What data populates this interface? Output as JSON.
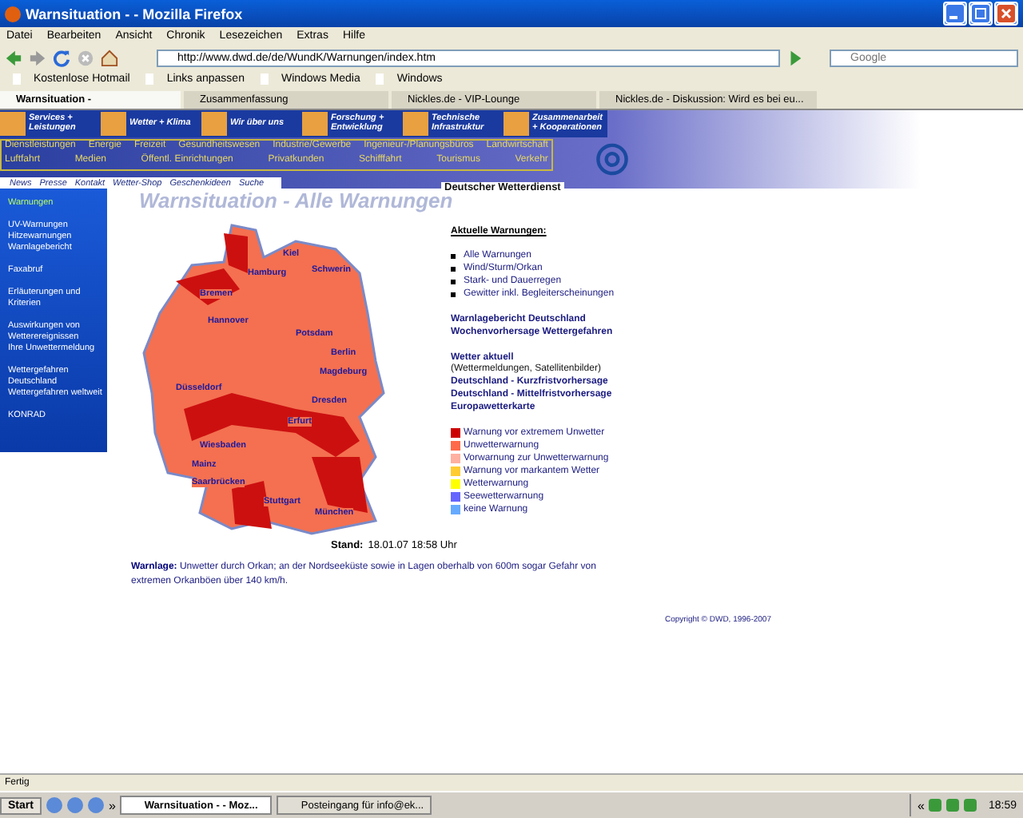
{
  "window": {
    "title": "Warnsituation - - Mozilla Firefox"
  },
  "menu": [
    "Datei",
    "Bearbeiten",
    "Ansicht",
    "Chronik",
    "Lesezeichen",
    "Extras",
    "Hilfe"
  ],
  "address": {
    "value": "http://www.dwd.de/de/WundK/Warnungen/index.htm"
  },
  "search": {
    "placeholder": "Google"
  },
  "bookmarks": [
    "Kostenlose Hotmail",
    "Links anpassen",
    "Windows Media",
    "Windows"
  ],
  "tabs": [
    {
      "label": "Warnsituation -",
      "selected": true
    },
    {
      "label": "Zusammenfassung",
      "selected": false
    },
    {
      "label": "Nickles.de - VIP-Lounge",
      "selected": false
    },
    {
      "label": "Nickles.de - Diskussion: Wird es bei eu...",
      "selected": false
    }
  ],
  "site": {
    "categories": [
      "Services + Leistungen",
      "Wetter + Klima",
      "Wir über uns",
      "Forschung + Entwicklung",
      "Technische Infrastruktur",
      "Zusammenarbeit + Kooperationen"
    ],
    "sectors": [
      [
        "Dienstleistungen",
        "Energie",
        "Freizeit",
        "Gesundheitswesen",
        "Industrie/Gewerbe",
        "Ingenieur-/Planungsbüros",
        "Landwirtschaft"
      ],
      [
        "Luftfahrt",
        "Medien",
        "Öffentl. Einrichtungen",
        "Privatkunden",
        "Schifffahrt",
        "Tourismus",
        "Verkehr"
      ]
    ],
    "subnav": [
      "News",
      "Presse",
      "Kontakt",
      "Wetter-Shop",
      "Geschenkideen",
      "Suche"
    ],
    "org": "Deutscher Wetterdienst",
    "sidebar": [
      {
        "items": [
          "Warnungen"
        ],
        "selected": true
      },
      {
        "items": [
          "UV-Warnungen",
          "Hitzewarnungen",
          "Warnlagebericht"
        ],
        "selected": false
      },
      {
        "items": [
          "Faxabruf"
        ],
        "selected": false
      },
      {
        "items": [
          "Erläuterungen und Kriterien"
        ],
        "selected": false
      },
      {
        "items": [
          "Auswirkungen von Wetterereignissen",
          "Ihre Unwettermeldung"
        ],
        "selected": false
      },
      {
        "items": [
          "Wettergefahren Deutschland",
          "Wettergefahren weltweit"
        ],
        "selected": false
      },
      {
        "items": [
          "KONRAD"
        ],
        "selected": false
      }
    ],
    "heading": "Warnsituation - Alle Warnungen",
    "cities": [
      "Kiel",
      "Hamburg",
      "Schwerin",
      "Bremen",
      "Hannover",
      "Potsdam",
      "Berlin",
      "Magdeburg",
      "Düsseldorf",
      "Dresden",
      "Erfurt",
      "Wiesbaden",
      "Mainz",
      "Saarbrücken",
      "Stuttgart",
      "München"
    ],
    "current_title": "Aktuelle Warnungen:",
    "current_links": [
      "Alle Warnungen",
      "Wind/Sturm/Orkan",
      "Stark- und Dauerregen",
      "Gewitter inkl. Begleiterscheinungen"
    ],
    "link_groups": [
      [
        {
          "text": "Warnlagebericht Deutschland",
          "kind": "link"
        },
        {
          "text": "Wochenvorhersage Wettergefahren",
          "kind": "link"
        }
      ],
      [
        {
          "text": "Wetter aktuell",
          "kind": "link"
        },
        {
          "text": "(Wettermeldungen, Satellitenbilder)",
          "kind": "note"
        },
        {
          "text": "Deutschland - Kurzfristvorhersage",
          "kind": "link"
        },
        {
          "text": "Deutschland - Mittelfristvorhersage",
          "kind": "link"
        },
        {
          "text": "Europawetterkarte",
          "kind": "link"
        }
      ]
    ],
    "legend": [
      {
        "label": "Warnung vor extremem Unwetter",
        "color": "#cc0000"
      },
      {
        "label": "Unwetterwarnung",
        "color": "#ff6a4a"
      },
      {
        "label": "Vorwarnung zur Unwetterwarnung",
        "color": "#ffb0a0"
      },
      {
        "label": "Warnung vor markantem Wetter",
        "color": "#ffcc33"
      },
      {
        "label": "Wetterwarnung",
        "color": "#ffff00"
      },
      {
        "label": "Seewetterwarnung",
        "color": "#6666ff"
      },
      {
        "label": "keine Warnung",
        "color": "#66aaff"
      }
    ],
    "stand": {
      "label": "Stand:",
      "value": "18.01.07 18:58 Uhr"
    },
    "warnlage": "**Warnlage:** Unwetter durch Orkan; an der Nordseeküste sowie in Lagen oberhalb von 600m sogar Gefahr von extremen Orkanböen über 140 km/h.",
    "copyright": "Copyright © DWD, 1996-2007"
  },
  "status_bar": "Fertig",
  "taskbar": {
    "start": "Start",
    "quicklaunch_more": "»",
    "tasks": [
      {
        "label": "Warnsituation - - Moz...",
        "selected": true
      },
      {
        "label": "Posteingang für info@ek...",
        "selected": false
      }
    ],
    "tray_more": "«",
    "clock": "18:59"
  }
}
